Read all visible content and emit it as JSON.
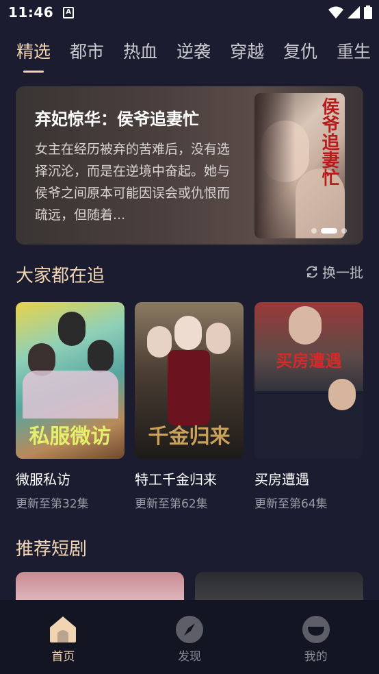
{
  "status_bar": {
    "time": "11:46",
    "app_icon": "A"
  },
  "tabs": [
    "精选",
    "都市",
    "热血",
    "逆袭",
    "穿越",
    "复仇",
    "重生"
  ],
  "banner": {
    "title": "弃妃惊华：侯爷追妻忙",
    "description": "女主在经历被弃的苦难后，没有选择沉沦，而是在逆境中奋起。她与侯爷之间原本可能因误会或仇恨而疏远，但随着...",
    "poster_text": "侯爷追妻忙"
  },
  "trending": {
    "title": "大家都在追",
    "refresh_label": "换一批",
    "items": [
      {
        "title": "微服私访",
        "sub": "更新至第32集",
        "poster_text": "私服微访"
      },
      {
        "title": "特工千金归来",
        "sub": "更新至第62集",
        "poster_text": "千金归来"
      },
      {
        "title": "买房遭遇",
        "sub": "更新至第64集",
        "poster_text": "买房遭遇"
      }
    ]
  },
  "recommend": {
    "title": "推荐短剧"
  },
  "bottom_nav": [
    {
      "label": "首页",
      "icon": "home-icon"
    },
    {
      "label": "发现",
      "icon": "compass-icon"
    },
    {
      "label": "我的",
      "icon": "profile-icon"
    }
  ],
  "colors": {
    "accent": "#f1d5b3",
    "background": "#1b1c30",
    "nav_bg": "#141522"
  }
}
